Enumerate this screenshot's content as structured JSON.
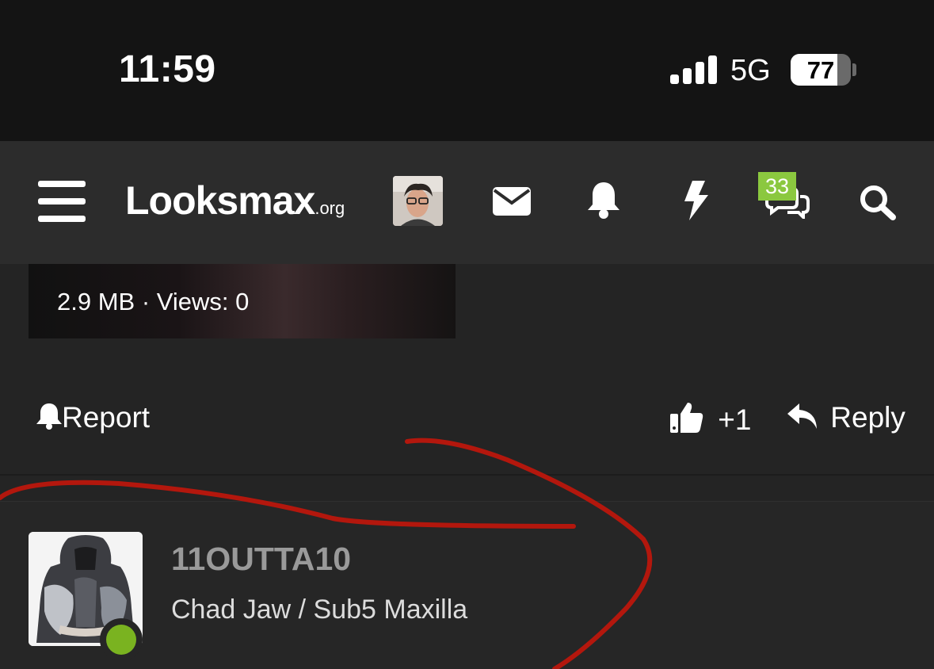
{
  "status_bar": {
    "time": "11:59",
    "network": "5G",
    "battery_percent": "77",
    "battery_level": 0.77
  },
  "navbar": {
    "logo_main": "Looksmax",
    "logo_suffix": ".org",
    "icons": [
      "menu-icon",
      "avatar",
      "envelope-icon",
      "bell-icon",
      "bolt-icon",
      "chat-icon",
      "search-icon"
    ],
    "chat_badge": "33",
    "badge_color": "#8bc83f"
  },
  "attachment": {
    "meta": "2.9 MB · Views: 0"
  },
  "post_actions": {
    "report_label": "Report",
    "like_count": "+1",
    "reply_label": "Reply"
  },
  "next_post": {
    "username": "11OUTTA10",
    "user_title": "Chad Jaw / Sub5 Maxilla",
    "online_color": "#7ab320"
  },
  "annotation_color": "#b3170d"
}
